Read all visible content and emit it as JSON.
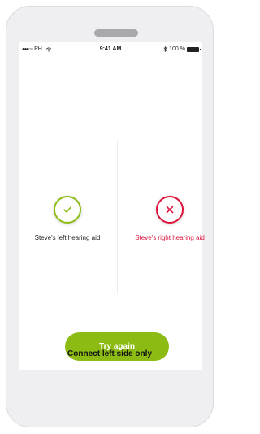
{
  "status_bar": {
    "carrier": "PH",
    "time": "9:41 AM",
    "battery": "100 %",
    "signal_icon": "signal-dots-icon",
    "wifi_icon": "wifi-icon",
    "bluetooth_icon": "bluetooth-icon",
    "battery_icon": "battery-icon"
  },
  "left": {
    "label": "Steve's left hearing aid",
    "status_icon": "check-icon",
    "color": "#8cbc14"
  },
  "right": {
    "label": "Steve's right hearing aid",
    "status_icon": "close-icon",
    "color": "#e0123c"
  },
  "actions": {
    "try_again": "Try again",
    "connect_left": "Connect left side only"
  }
}
